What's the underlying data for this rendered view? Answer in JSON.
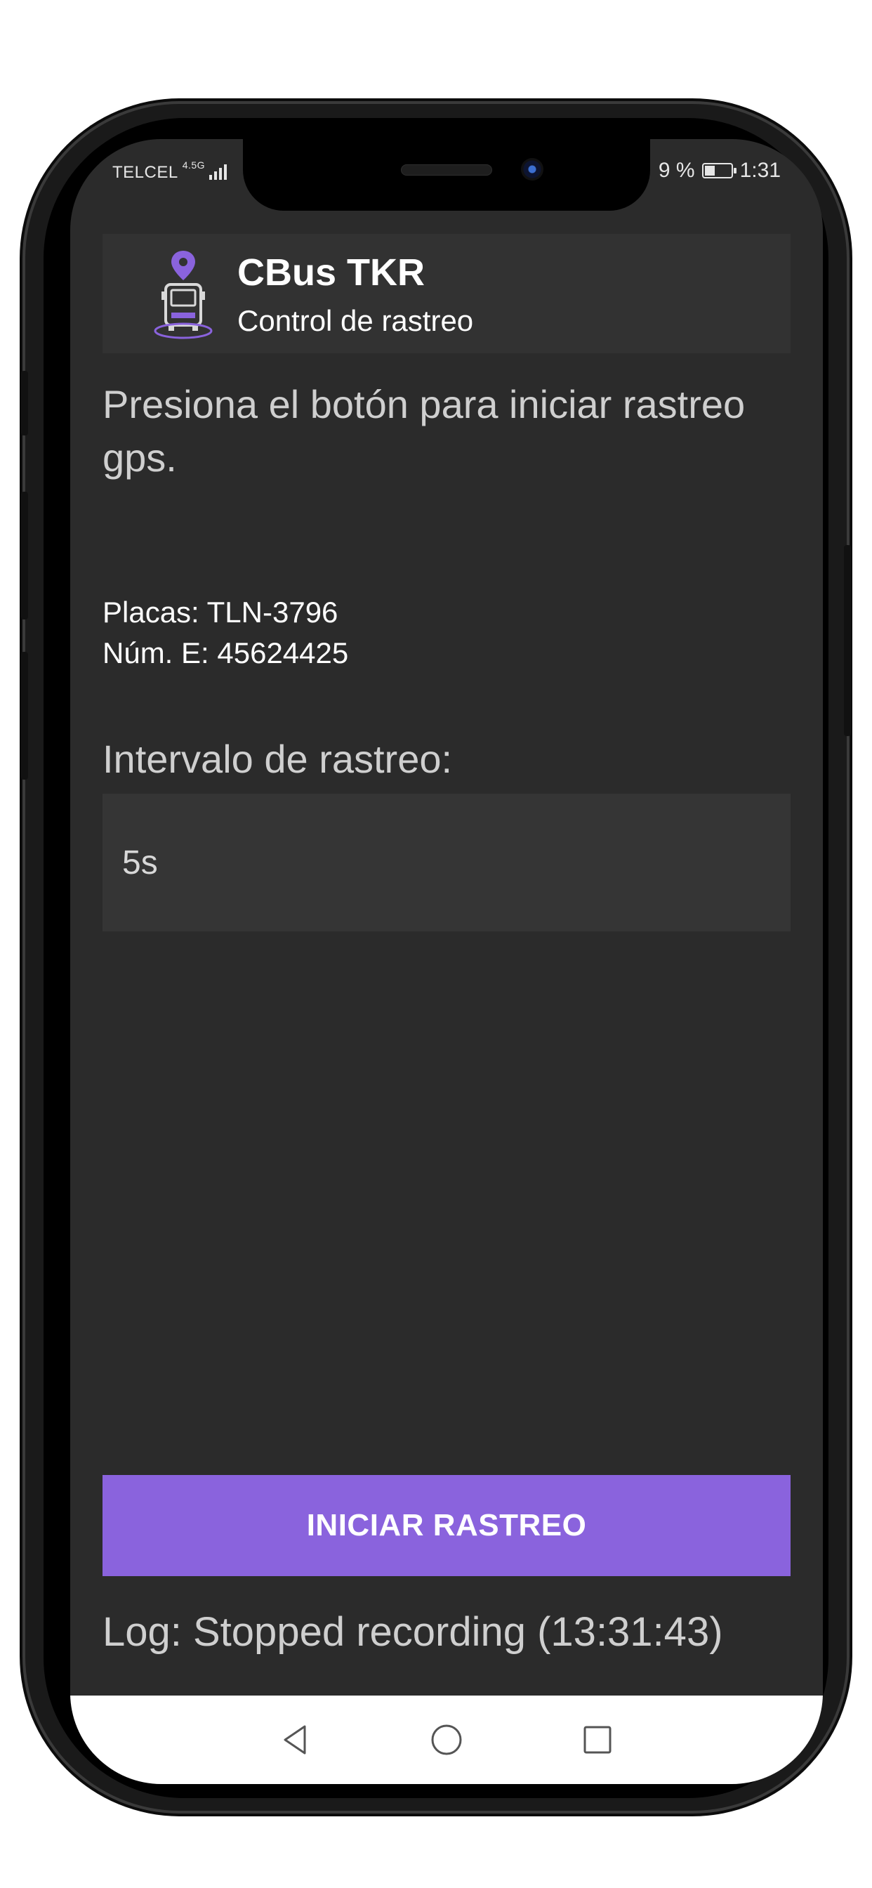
{
  "status_bar": {
    "carrier": "TELCEL",
    "network": "4.5G",
    "battery_text": "9 %",
    "time": "1:31"
  },
  "app": {
    "name": "CBus TKR",
    "subtitle": "Control de rastreo",
    "logo_icon": "bus-location-pin-icon",
    "accent_color": "#8a63dd"
  },
  "main": {
    "instructions": "Presiona el botón para iniciar rastreo gps.",
    "plates": "Placas: TLN-3796",
    "employee_number": "Núm. E: 45624425",
    "interval_label": "Intervalo de rastreo:",
    "interval_value": "5s",
    "start_button_label": "INICIAR RASTREO",
    "log": "Log: Stopped recording (13:31:43)"
  },
  "navbar": {
    "back_icon": "back-triangle-icon",
    "home_icon": "home-circle-icon",
    "recents_icon": "recents-square-icon"
  }
}
